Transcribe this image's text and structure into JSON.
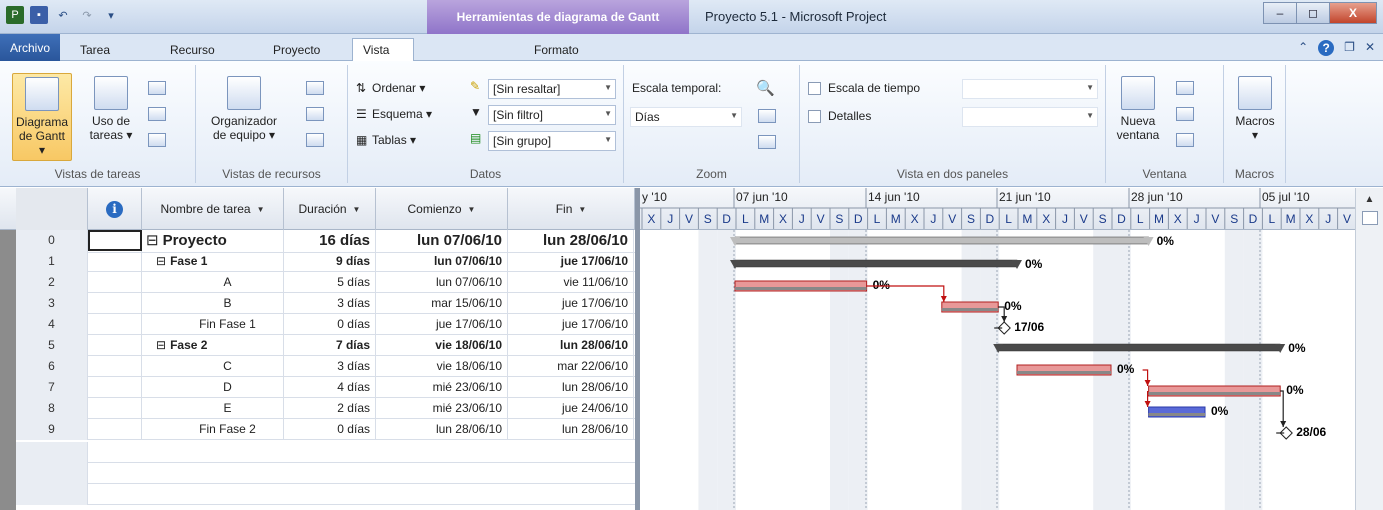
{
  "titlebar": {
    "context_tab": "Herramientas de diagrama de Gantt",
    "title": "Proyecto 5.1  -  Microsoft Project",
    "min": "–",
    "max": "◻",
    "close": "X"
  },
  "tabs": [
    {
      "label": "Archivo"
    },
    {
      "label": "Tarea"
    },
    {
      "label": "Recurso"
    },
    {
      "label": "Proyecto"
    },
    {
      "label": "Vista"
    },
    {
      "label": "Formato"
    }
  ],
  "ribbon": {
    "task_views": {
      "gantt_l1": "Diagrama",
      "gantt_l2": "de Gantt ▾",
      "usage_l1": "Uso de",
      "usage_l2": "tareas ▾",
      "label": "Vistas de tareas"
    },
    "resource_views": {
      "team_l1": "Organizador",
      "team_l2": "de equipo ▾",
      "label": "Vistas de recursos"
    },
    "data": {
      "sort": "Ordenar ▾",
      "outline": "Esquema ▾",
      "tables": "Tablas ▾",
      "highlight": "[Sin resaltar]",
      "filter": "[Sin filtro]",
      "group": "[Sin grupo]",
      "label": "Datos"
    },
    "zoom": {
      "timescale_label": "Escala temporal:",
      "timescale_value": "Días",
      "label": "Zoom"
    },
    "split": {
      "timeline": "Escala de tiempo",
      "details": "Detalles",
      "label": "Vista en dos paneles"
    },
    "window": {
      "new_l1": "Nueva",
      "new_l2": "ventana",
      "label": "Ventana"
    },
    "macros": {
      "btn": "Macros",
      "label": "Macros"
    }
  },
  "columns": {
    "name": "Nombre de tarea",
    "duration": "Duración",
    "start": "Comienzo",
    "end": "Fin",
    "info": "i"
  },
  "rows": [
    {
      "id": "0",
      "name": "Proyecto",
      "dur": "16 días",
      "start": "lun 07/06/10",
      "end": "lun 28/06/10",
      "level": 0,
      "summary": true
    },
    {
      "id": "1",
      "name": "Fase 1",
      "dur": "9 días",
      "start": "lun 07/06/10",
      "end": "jue 17/06/10",
      "level": 1,
      "summary": true
    },
    {
      "id": "2",
      "name": "A",
      "dur": "5 días",
      "start": "lun 07/06/10",
      "end": "vie 11/06/10",
      "level": 2,
      "summary": false
    },
    {
      "id": "3",
      "name": "B",
      "dur": "3 días",
      "start": "mar 15/06/10",
      "end": "jue 17/06/10",
      "level": 2,
      "summary": false
    },
    {
      "id": "4",
      "name": "Fin Fase 1",
      "dur": "0 días",
      "start": "jue 17/06/10",
      "end": "jue 17/06/10",
      "level": 2,
      "summary": false
    },
    {
      "id": "5",
      "name": "Fase 2",
      "dur": "7 días",
      "start": "vie 18/06/10",
      "end": "lun 28/06/10",
      "level": 1,
      "summary": true
    },
    {
      "id": "6",
      "name": "C",
      "dur": "3 días",
      "start": "vie 18/06/10",
      "end": "mar 22/06/10",
      "level": 2,
      "summary": false
    },
    {
      "id": "7",
      "name": "D",
      "dur": "4 días",
      "start": "mié 23/06/10",
      "end": "lun 28/06/10",
      "level": 2,
      "summary": false
    },
    {
      "id": "8",
      "name": "E",
      "dur": "2 días",
      "start": "mié 23/06/10",
      "end": "jue 24/06/10",
      "level": 2,
      "summary": false
    },
    {
      "id": "9",
      "name": "Fin Fase 2",
      "dur": "0 días",
      "start": "lun 28/06/10",
      "end": "lun 28/06/10",
      "level": 2,
      "summary": false
    }
  ],
  "timescale": {
    "weeks": [
      "y '10",
      "07 jun '10",
      "14 jun '10",
      "21 jun '10",
      "28 jun '10",
      "05 jul '10"
    ],
    "days": [
      "X",
      "J",
      "V",
      "S",
      "D",
      "L",
      "M",
      "X",
      "J",
      "V",
      "S",
      "D",
      "L",
      "M",
      "X",
      "J",
      "V",
      "S",
      "D",
      "L",
      "M",
      "X",
      "J",
      "V",
      "S",
      "D",
      "L",
      "M",
      "X",
      "J",
      "V",
      "S",
      "D",
      "L",
      "M",
      "X",
      "J",
      "V"
    ]
  },
  "gantt": {
    "bars": [
      {
        "row": 0,
        "type": "summary",
        "start": 0,
        "end": 22,
        "pct": "0%"
      },
      {
        "row": 1,
        "type": "summary",
        "start": 0,
        "end": 15,
        "pct": "0%"
      },
      {
        "row": 2,
        "type": "task",
        "start": 0,
        "end": 7,
        "pct": "0%",
        "color": "red"
      },
      {
        "row": 3,
        "type": "task",
        "start": 11,
        "end": 14,
        "pct": "0%",
        "color": "red"
      },
      {
        "row": 4,
        "type": "milestone",
        "start": 14,
        "label": "17/06"
      },
      {
        "row": 5,
        "type": "summary",
        "start": 14,
        "end": 29,
        "pct": "0%"
      },
      {
        "row": 6,
        "type": "task",
        "start": 15,
        "end": 20,
        "pct": "0%",
        "color": "red"
      },
      {
        "row": 7,
        "type": "task",
        "start": 22,
        "end": 29,
        "pct": "0%",
        "color": "red"
      },
      {
        "row": 8,
        "type": "task",
        "start": 22,
        "end": 25,
        "pct": "0%",
        "color": "blue"
      },
      {
        "row": 9,
        "type": "milestone",
        "start": 29,
        "label": "28/06"
      }
    ]
  }
}
